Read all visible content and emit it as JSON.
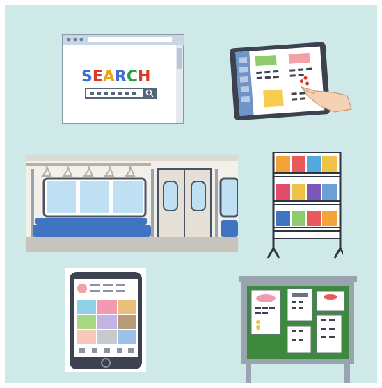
{
  "browser": {
    "search_word": "SEARCH",
    "search_letters": [
      "S",
      "E",
      "A",
      "R",
      "C",
      "H"
    ]
  },
  "colors": {
    "background": "#cfe8e8",
    "border": "#ffffff",
    "google_blue": "#3b6fd6",
    "google_red": "#d8392b",
    "google_yellow": "#e8a617",
    "google_green": "#2e9d4a",
    "board_green": "#3d8a3f",
    "train_seat": "#3f74c2"
  },
  "icons": {
    "browser": "browser-search-icon",
    "tablet": "tablet-touch-icon",
    "train": "train-interior-icon",
    "magazine_rack": "magazine-rack-icon",
    "smartphone": "smartphone-app-icon",
    "bulletin_board": "bulletin-board-icon"
  }
}
